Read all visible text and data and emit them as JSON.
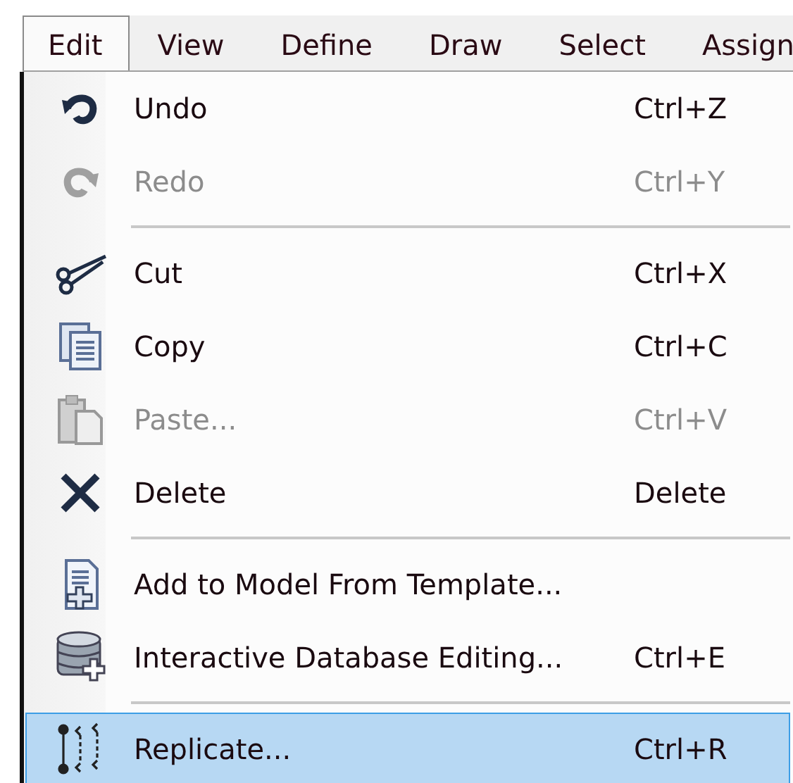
{
  "menubar": [
    {
      "label": "Edit",
      "selected": true
    },
    {
      "label": "View",
      "selected": false
    },
    {
      "label": "Define",
      "selected": false
    },
    {
      "label": "Draw",
      "selected": false
    },
    {
      "label": "Select",
      "selected": false
    },
    {
      "label": "Assign",
      "selected": false
    }
  ],
  "menu": [
    {
      "kind": "item",
      "label": "Undo",
      "shortcut": "Ctrl+Z",
      "disabled": false,
      "selected": false
    },
    {
      "kind": "item",
      "label": "Redo",
      "shortcut": "Ctrl+Y",
      "disabled": true,
      "selected": false
    },
    {
      "kind": "separator"
    },
    {
      "kind": "item",
      "label": "Cut",
      "shortcut": "Ctrl+X",
      "disabled": false,
      "selected": false
    },
    {
      "kind": "item",
      "label": "Copy",
      "shortcut": "Ctrl+C",
      "disabled": false,
      "selected": false
    },
    {
      "kind": "item",
      "label": "Paste...",
      "shortcut": "Ctrl+V",
      "disabled": true,
      "selected": false
    },
    {
      "kind": "item",
      "label": "Delete",
      "shortcut": "Delete",
      "disabled": false,
      "selected": false
    },
    {
      "kind": "separator"
    },
    {
      "kind": "item",
      "label": "Add to Model From Template...",
      "disabled": false,
      "selected": false
    },
    {
      "kind": "item",
      "label": "Interactive Database Editing...",
      "shortcut": "Ctrl+E",
      "disabled": false,
      "selected": false
    },
    {
      "kind": "separator"
    },
    {
      "kind": "item",
      "label": "Replicate...",
      "shortcut": "Ctrl+R",
      "disabled": false,
      "selected": true
    }
  ]
}
